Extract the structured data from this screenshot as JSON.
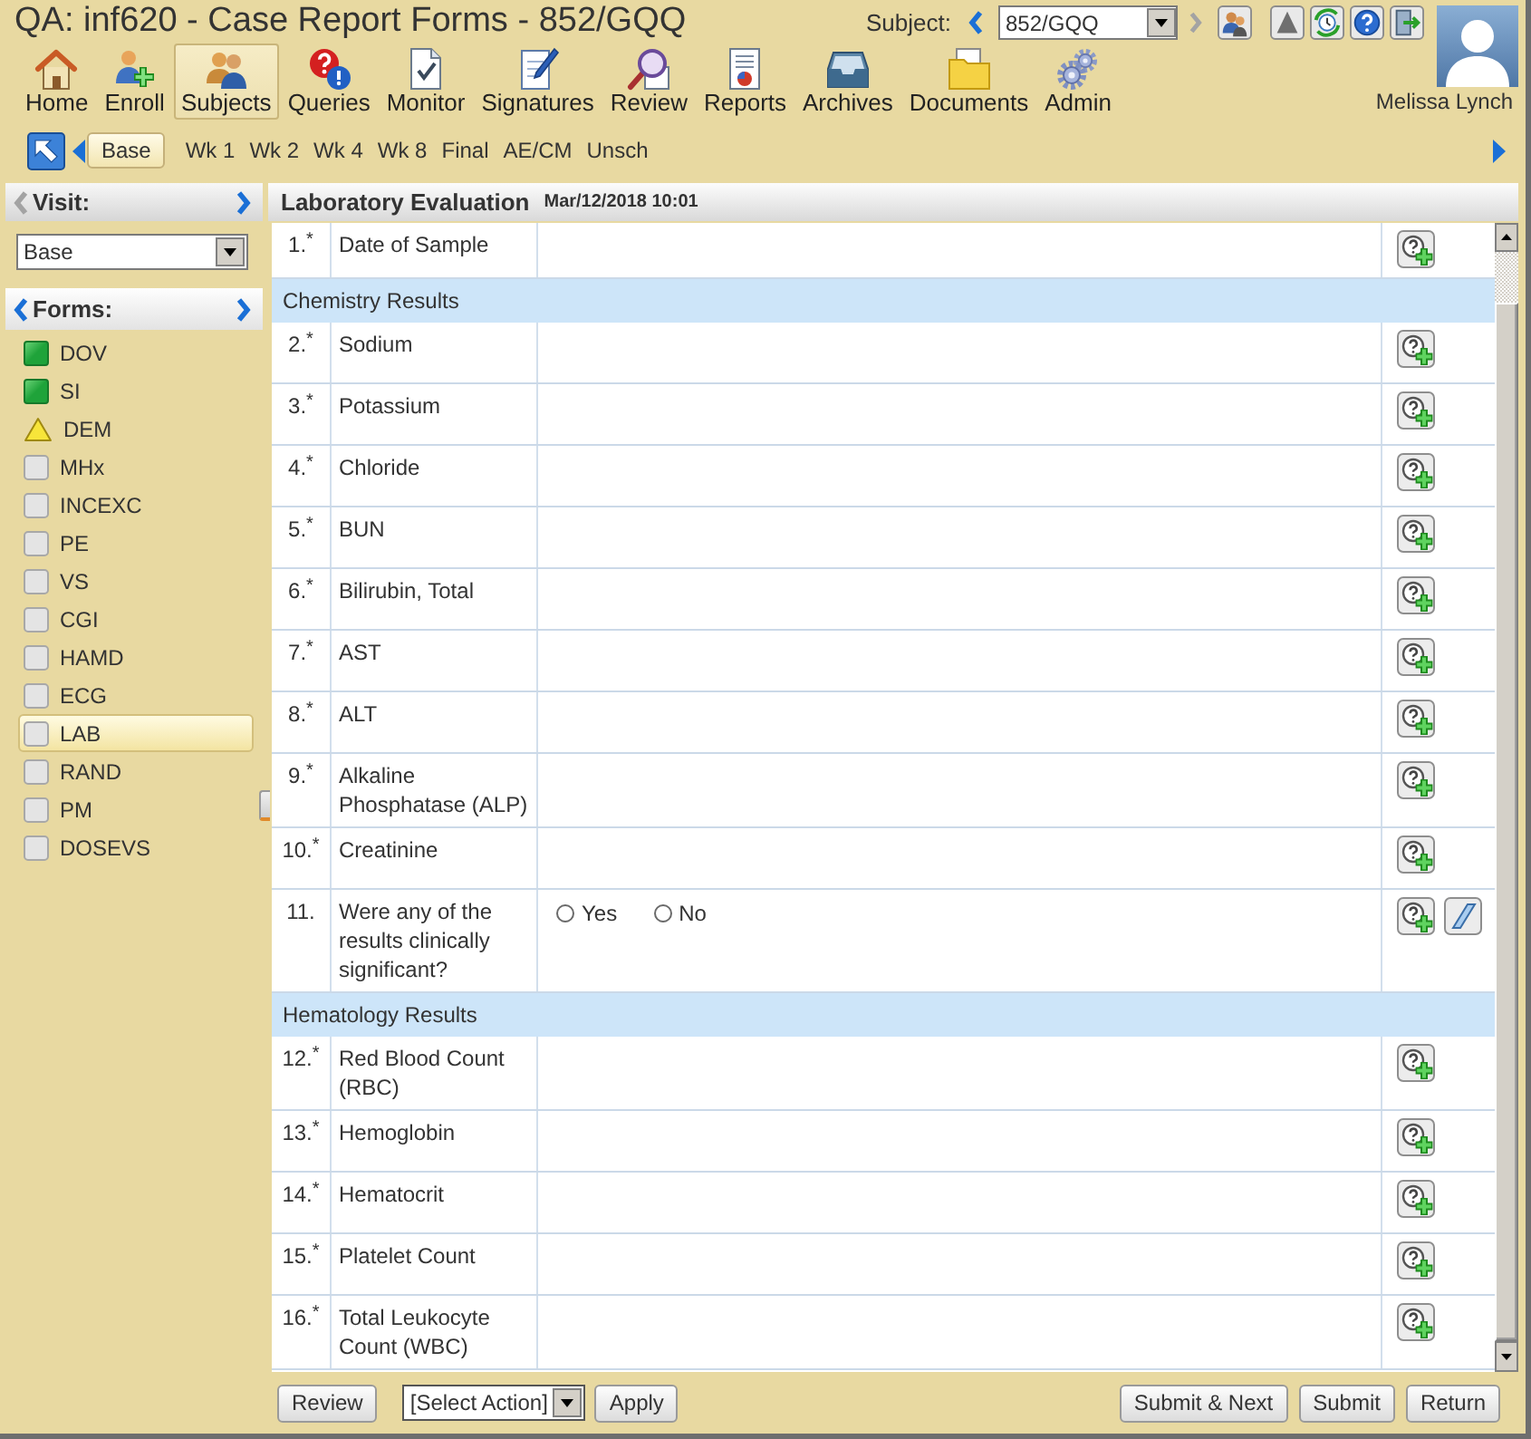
{
  "window": {
    "title": "QA: inf620 - Case Report Forms - 852/GQQ"
  },
  "subject_picker": {
    "label": "Subject:",
    "value": "852/GQQ",
    "prev_enabled": true,
    "next_enabled": false
  },
  "toolbar": [
    {
      "kind": "home",
      "label": "Home",
      "selected": false
    },
    {
      "kind": "enroll",
      "label": "Enroll",
      "selected": false
    },
    {
      "kind": "subjects",
      "label": "Subjects",
      "selected": true
    },
    {
      "kind": "queries",
      "label": "Queries",
      "selected": false
    },
    {
      "kind": "monitor",
      "label": "Monitor",
      "selected": false
    },
    {
      "kind": "signatures",
      "label": "Signatures",
      "selected": false
    },
    {
      "kind": "review",
      "label": "Review",
      "selected": false
    },
    {
      "kind": "reports",
      "label": "Reports",
      "selected": false
    },
    {
      "kind": "archives",
      "label": "Archives",
      "selected": false
    },
    {
      "kind": "documents",
      "label": "Documents",
      "selected": false
    },
    {
      "kind": "admin",
      "label": "Admin",
      "selected": false
    }
  ],
  "user": {
    "name": "Melissa Lynch"
  },
  "visit_tabs": [
    {
      "label": "Base",
      "selected": true
    },
    {
      "label": "Wk 1",
      "selected": false
    },
    {
      "label": "Wk 2",
      "selected": false
    },
    {
      "label": "Wk 4",
      "selected": false
    },
    {
      "label": "Wk 8",
      "selected": false
    },
    {
      "label": "Final",
      "selected": false
    },
    {
      "label": "AE/CM",
      "selected": false
    },
    {
      "label": "Unsch",
      "selected": false
    }
  ],
  "sidebar": {
    "visit": {
      "title": "Visit:",
      "value": "Base",
      "prev_enabled": false,
      "next_enabled": true
    },
    "forms": {
      "title": "Forms:",
      "prev_enabled": true,
      "next_enabled": true,
      "items": [
        {
          "label": "DOV",
          "kind": "complete",
          "selected": false
        },
        {
          "label": "SI",
          "kind": "complete",
          "selected": false
        },
        {
          "label": "DEM",
          "kind": "warning",
          "selected": false
        },
        {
          "label": "MHx",
          "kind": "empty",
          "selected": false
        },
        {
          "label": "INCEXC",
          "kind": "empty",
          "selected": false
        },
        {
          "label": "PE",
          "kind": "empty",
          "selected": false
        },
        {
          "label": "VS",
          "kind": "empty",
          "selected": false
        },
        {
          "label": "CGI",
          "kind": "empty",
          "selected": false
        },
        {
          "label": "HAMD",
          "kind": "empty",
          "selected": false
        },
        {
          "label": "ECG",
          "kind": "empty",
          "selected": false
        },
        {
          "label": "LAB",
          "kind": "empty",
          "selected": true
        },
        {
          "label": "RAND",
          "kind": "empty",
          "selected": false
        },
        {
          "label": "PM",
          "kind": "empty",
          "selected": false
        },
        {
          "label": "DOSEVS",
          "kind": "empty",
          "selected": false
        }
      ]
    }
  },
  "form": {
    "title": "Laboratory Evaluation",
    "timestamp": "Mar/12/2018 10:01",
    "rows": [
      {
        "kind": "question",
        "number": "1.$^{*}$",
        "label": "Date of Sample",
        "clear_button": false
      },
      {
        "kind": "section",
        "label": "Chemistry Results"
      },
      {
        "kind": "question",
        "number": "2.$^{*}$",
        "label": "Sodium",
        "clear_button": false
      },
      {
        "kind": "question",
        "number": "3.$^{*}$",
        "label": "Potassium",
        "clear_button": false
      },
      {
        "kind": "question",
        "number": "4.$^{*}$",
        "label": "Chloride",
        "clear_button": false
      },
      {
        "kind": "question",
        "number": "5.$^{*}$",
        "label": "BUN",
        "clear_button": false
      },
      {
        "kind": "question",
        "number": "6.$^{*}$",
        "label": "Bilirubin, Total",
        "clear_button": false
      },
      {
        "kind": "question",
        "number": "7.$^{*}$",
        "label": "AST",
        "clear_button": false
      },
      {
        "kind": "question",
        "number": "8.$^{*}$",
        "label": "ALT",
        "clear_button": false
      },
      {
        "kind": "question",
        "number": "9.$^{*}$",
        "label": "Alkaline Phosphatase (ALP)",
        "clear_button": false
      },
      {
        "kind": "question",
        "number": "10.$^{*}$",
        "label": "Creatinine",
        "clear_button": false
      },
      {
        "kind": "question",
        "number": "11.",
        "label": "Were any of the results clinically significant?",
        "options": [
          {
            "label": "Yes",
            "selected": false
          },
          {
            "label": "No",
            "selected": false
          }
        ],
        "clear_button": true
      },
      {
        "kind": "section",
        "label": "Hematology Results"
      },
      {
        "kind": "question",
        "number": "12.$^{*}$",
        "label": "Red Blood Count (RBC)",
        "clear_button": false
      },
      {
        "kind": "question",
        "number": "13.$^{*}$",
        "label": "Hemoglobin",
        "clear_button": false
      },
      {
        "kind": "question",
        "number": "14.$^{*}$",
        "label": "Hematocrit",
        "clear_button": false
      },
      {
        "kind": "question",
        "number": "15.$^{*}$",
        "label": "Platelet Count",
        "clear_button": false
      },
      {
        "kind": "question",
        "number": "16.$^{*}$",
        "label": "Total Leukocyte Count (WBC)",
        "clear_button": false
      }
    ]
  },
  "footer": {
    "review_button": "Review",
    "action_select": "[Select Action]",
    "apply_button": "Apply",
    "buttons": [
      "Submit & Next",
      "Submit",
      "Return"
    ]
  }
}
